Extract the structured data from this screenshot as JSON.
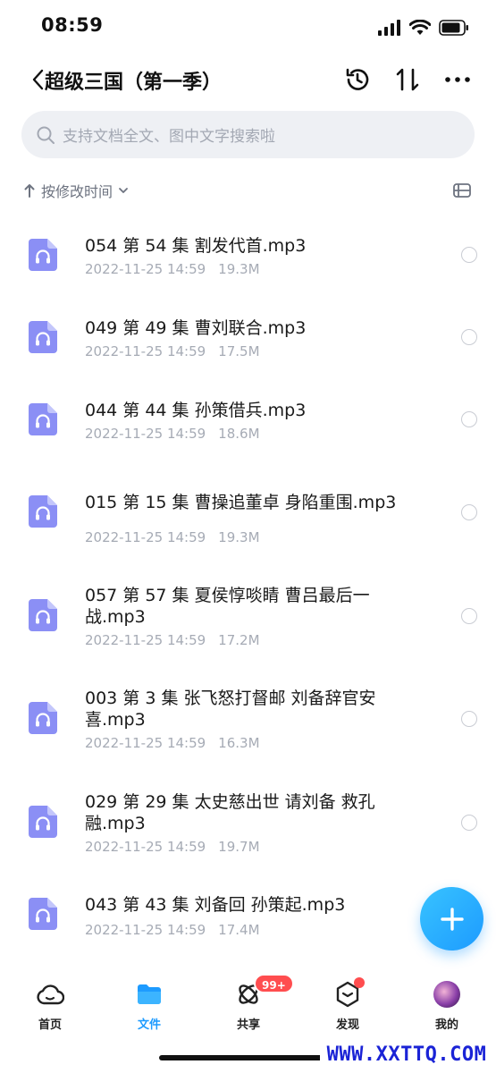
{
  "status_bar": {
    "time": "08:59"
  },
  "header": {
    "title": "超级三国（第一季）"
  },
  "search": {
    "placeholder": "支持文档全文、图中文字搜索啦"
  },
  "sort": {
    "label": "按修改时间"
  },
  "files": [
    {
      "name": "054 第 54 集 割发代首.mp3",
      "date": "2022-11-25 14:59",
      "size": "19.3M"
    },
    {
      "name": "049 第 49 集 曹刘联合.mp3",
      "date": "2022-11-25 14:59",
      "size": "17.5M"
    },
    {
      "name": "044 第 44 集 孙策借兵.mp3",
      "date": "2022-11-25 14:59",
      "size": "18.6M"
    },
    {
      "name": "015 第 15 集 曹操追董卓 身陷重围.mp3",
      "date": "2022-11-25 14:59",
      "size": "19.3M"
    },
    {
      "name": "057 第 57 集 夏侯惇啖睛 曹吕最后一战.mp3",
      "date": "2022-11-25 14:59",
      "size": "17.2M"
    },
    {
      "name": "003 第 3 集 张飞怒打督邮 刘备辞官安喜.mp3",
      "date": "2022-11-25 14:59",
      "size": "16.3M"
    },
    {
      "name": "029 第 29 集 太史慈出世 请刘备 救孔融.mp3",
      "date": "2022-11-25 14:59",
      "size": "19.7M"
    },
    {
      "name": "043 第 43 集 刘备回 孙策起.mp3",
      "date": "2022-11-25 14:59",
      "size": "17.4M"
    }
  ],
  "tabs": [
    {
      "label": "首页"
    },
    {
      "label": "文件"
    },
    {
      "label": "共享",
      "badge": "99+"
    },
    {
      "label": "发现"
    },
    {
      "label": "我的"
    }
  ],
  "watermark": "WWW.XXTTQ.COM",
  "colors": {
    "accent": "#1d9bff",
    "file_icon": "#8b8ff5",
    "badge": "#ff4d4f",
    "watermark": "#1a23d6"
  }
}
